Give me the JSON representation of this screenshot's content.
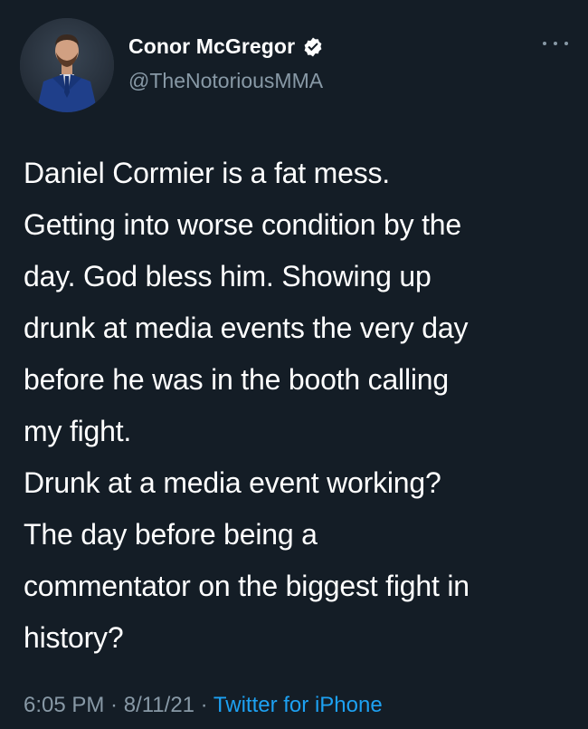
{
  "author": {
    "display_name": "Conor McGregor",
    "handle": "@TheNotoriousMMA",
    "verified": true,
    "avatar_icon": "profile-photo"
  },
  "more_icon": "ellipsis-icon",
  "tweet": {
    "text": "Daniel Cormier is a fat mess.\nGetting into worse condition by the\nday. God bless him. Showing up\ndrunk at media events the very day\nbefore he was in the booth calling\nmy fight.\nDrunk at a media event working?\nThe day before being a\ncommentator on the biggest fight in\nhistory?"
  },
  "meta": {
    "time": "6:05 PM",
    "separator": " · ",
    "date": "8/11/21",
    "source": "Twitter for iPhone"
  },
  "colors": {
    "background": "#141d26",
    "text": "#ffffff",
    "secondary": "#8899a6",
    "link": "#1da1f2"
  }
}
